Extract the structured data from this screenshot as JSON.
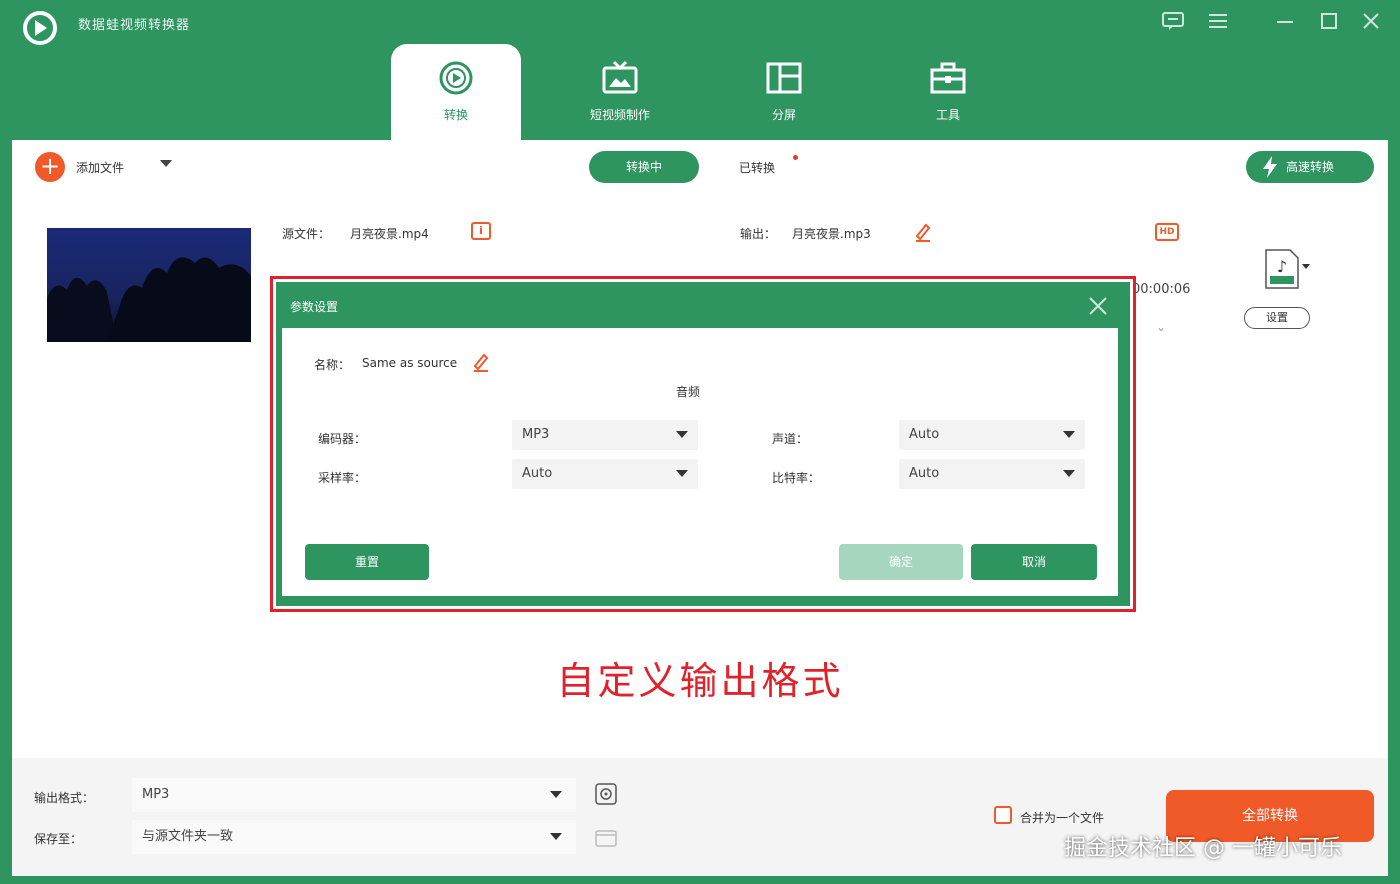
{
  "app": {
    "title": "数据蛙视频转换器"
  },
  "window_controls": [
    "feedback-icon",
    "menu-icon",
    "minimize-icon",
    "maximize-icon",
    "close-icon"
  ],
  "tabs": [
    {
      "label": "转换",
      "icon": "convert-icon",
      "active": true
    },
    {
      "label": "短视频制作",
      "icon": "tv-icon",
      "active": false
    },
    {
      "label": "分屏",
      "icon": "split-screen-icon",
      "active": false
    },
    {
      "label": "工具",
      "icon": "toolbox-icon",
      "active": false
    }
  ],
  "toolbar": {
    "add_file_label": "添加文件",
    "converting_label": "转换中",
    "converted_label": "已转换",
    "speed_convert_label": "高速转换"
  },
  "file": {
    "source_label": "源文件：",
    "source_name": "月亮夜景.mp4",
    "output_label": "输出：",
    "output_name": "月亮夜景.mp3",
    "duration": "00:00:06",
    "settings_label": "设置"
  },
  "dialog": {
    "title": "参数设置",
    "name_label": "名称：",
    "name_value": "Same as source",
    "section_title": "音频",
    "fields": {
      "encoder_label": "编码器：",
      "encoder_value": "MP3",
      "channel_label": "声道：",
      "channel_value": "Auto",
      "samplerate_label": "采样率：",
      "samplerate_value": "Auto",
      "bitrate_label": "比特率：",
      "bitrate_value": "Auto"
    },
    "reset_label": "重置",
    "ok_label": "确定",
    "cancel_label": "取消"
  },
  "caption": "自定义输出格式",
  "bottom": {
    "output_format_label": "输出格式：",
    "output_format_value": "MP3",
    "save_to_label": "保存至：",
    "save_to_value": "与源文件夹一致",
    "merge_label": "合并为一个文件",
    "convert_all_label": "全部转换"
  },
  "watermark": "掘金技术社区 @ 一罐小可乐",
  "colors": {
    "brand_green": "#2e9460",
    "accent_orange": "#f05a28",
    "highlight_red": "#e0232a"
  }
}
